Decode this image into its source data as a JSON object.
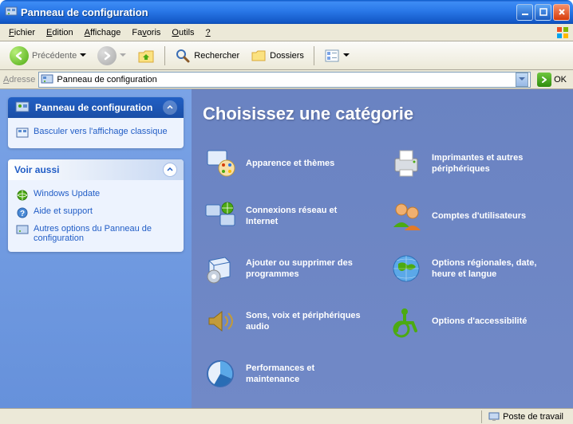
{
  "window": {
    "title": "Panneau de configuration"
  },
  "menu": {
    "file": "Fichier",
    "edit": "Edition",
    "view": "Affichage",
    "favorites": "Favoris",
    "tools": "Outils",
    "help": "?"
  },
  "toolbar": {
    "back": "Précédente",
    "search": "Rechercher",
    "folders": "Dossiers"
  },
  "addressbar": {
    "label": "Adresse",
    "value": "Panneau de configuration",
    "go": "OK"
  },
  "sidepanel": {
    "primary": {
      "title": "Panneau de configuration",
      "links": [
        {
          "label": "Basculer vers l'affichage classique"
        }
      ]
    },
    "seealso": {
      "title": "Voir aussi",
      "links": [
        {
          "label": "Windows Update"
        },
        {
          "label": "Aide et support"
        },
        {
          "label": "Autres options du Panneau de configuration"
        }
      ]
    }
  },
  "content": {
    "heading": "Choisissez une catégorie",
    "categories": [
      {
        "label": "Apparence et thèmes"
      },
      {
        "label": "Imprimantes et autres périphériques"
      },
      {
        "label": "Connexions réseau et Internet"
      },
      {
        "label": "Comptes d'utilisateurs"
      },
      {
        "label": "Ajouter ou supprimer des programmes"
      },
      {
        "label": "Options régionales, date, heure et langue"
      },
      {
        "label": "Sons, voix et périphériques audio"
      },
      {
        "label": "Options d'accessibilité"
      },
      {
        "label": "Performances et maintenance"
      }
    ]
  },
  "statusbar": {
    "location": "Poste de travail"
  }
}
